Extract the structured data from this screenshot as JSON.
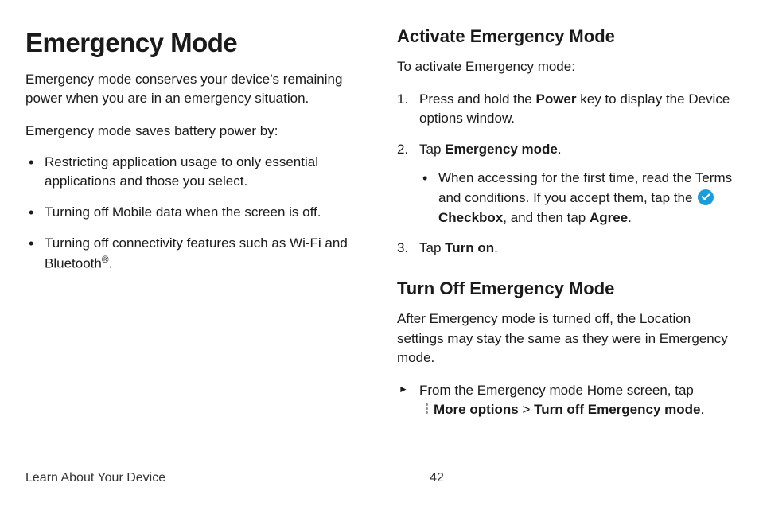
{
  "left": {
    "h1": "Emergency Mode",
    "intro": "Emergency mode conserves your device’s remaining power when you are in an emergency situation.",
    "lead": "Emergency mode saves battery power by:",
    "bullets": [
      "Restricting application usage to only essential applications and those you select.",
      "Turning off Mobile data when the screen is off.",
      "Turning off connectivity features such as Wi-Fi and Bluetooth"
    ],
    "registered": "®",
    "period": "."
  },
  "right": {
    "activate_h2": "Activate Emergency Mode",
    "activate_lead": "To activate Emergency mode:",
    "step1_a": "Press and hold the ",
    "step1_bold": "Power",
    "step1_b": " key to display the Device options window.",
    "step2_a": "Tap ",
    "step2_bold": "Emergency mode",
    "step2_b": ".",
    "step2_sub_a": "When accessing for the first time, read the Terms and conditions. If you accept them, tap the ",
    "checkbox_label": "Checkbox",
    "step2_sub_b": ", and then tap ",
    "agree": "Agree",
    "step2_sub_c": ".",
    "step3_a": "Tap ",
    "step3_bold": "Turn on",
    "step3_b": ".",
    "turnoff_h2": "Turn Off Emergency Mode",
    "turnoff_lead": "After Emergency mode is turned off, the Location settings may stay the same as they were in Emergency mode.",
    "arrow_a": "From the Emergency mode Home screen, tap ",
    "more_options": "More options",
    "gt": " > ",
    "turn_off": "Turn off Emergency mode",
    "arrow_b": "."
  },
  "footer": {
    "section": "Learn About Your Device",
    "page": "42"
  }
}
